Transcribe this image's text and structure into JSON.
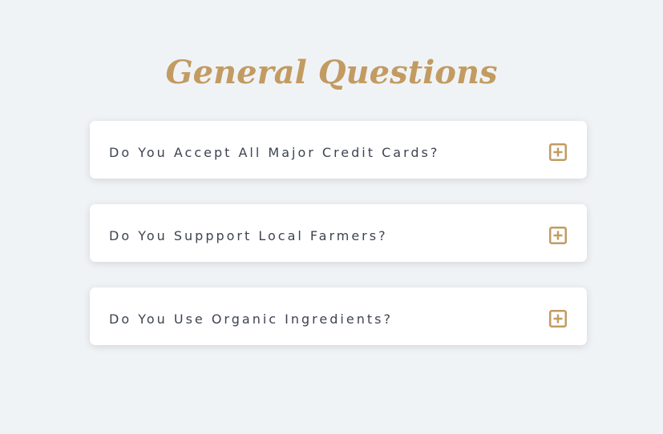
{
  "header": {
    "title": "General Questions"
  },
  "faq": {
    "items": [
      {
        "question": "Do You Accept All Major Credit Cards?",
        "icon": "plus-square-icon"
      },
      {
        "question": "Do You Suppport Local Farmers?",
        "icon": "plus-square-icon"
      },
      {
        "question": "Do You Use Organic Ingredients?",
        "icon": "plus-square-icon"
      }
    ]
  },
  "colors": {
    "accent": "#c29b62",
    "background": "#f0f3f6",
    "card": "#ffffff",
    "text": "#3d4350"
  }
}
